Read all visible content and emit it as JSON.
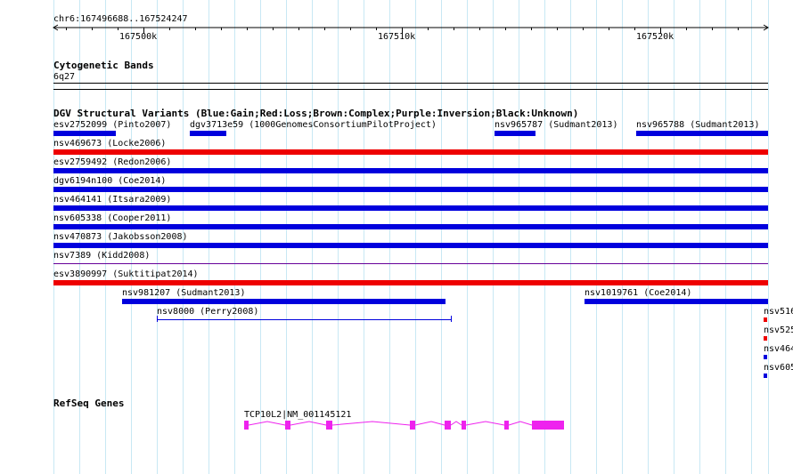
{
  "ruler": {
    "location": "chr6:167496688..167524247",
    "ticks": [
      "167500k",
      "167510k",
      "167520k"
    ]
  },
  "cytobands": {
    "title": "Cytogenetic Bands",
    "band": "6q27"
  },
  "dgv": {
    "title": "DGV Structural Variants (Blue:Gain;Red:Loss;Brown:Complex;Purple:Inversion;Black:Unknown)",
    "colors": {
      "gain": "#0000dd",
      "loss": "#ee0000",
      "inversion": "#660099"
    },
    "features": [
      {
        "label": "esv2752099 (Pinto2007)",
        "type": "gain"
      },
      {
        "label": "dgv3713e59 (1000GenomesConsortiumPilotProject)",
        "type": "gain"
      },
      {
        "label": "nsv965787 (Sudmant2013)",
        "type": "gain"
      },
      {
        "label": "nsv965788 (Sudmant2013)",
        "type": "gain"
      },
      {
        "label": "nsv469673 (Locke2006)",
        "type": "loss"
      },
      {
        "label": "esv2759492 (Redon2006)",
        "type": "gain"
      },
      {
        "label": "dgv6194n100 (Coe2014)",
        "type": "gain"
      },
      {
        "label": "nsv464141 (Itsara2009)",
        "type": "gain"
      },
      {
        "label": "nsv605338 (Cooper2011)",
        "type": "gain"
      },
      {
        "label": "nsv470873 (Jakobsson2008)",
        "type": "gain"
      },
      {
        "label": "nsv7389 (Kidd2008)",
        "type": "inversion"
      },
      {
        "label": "esv3890997 (Suktitipat2014)",
        "type": "loss"
      },
      {
        "label": "nsv981207 (Sudmant2013)",
        "type": "gain"
      },
      {
        "label": "nsv1019761 (Coe2014)",
        "type": "gain"
      },
      {
        "label": "nsv8000 (Perry2008)",
        "type": "gain"
      },
      {
        "label": "nsv516",
        "type": "loss"
      },
      {
        "label": "nsv525",
        "type": "loss"
      },
      {
        "label": "nsv464",
        "type": "gain"
      },
      {
        "label": "nsv605",
        "type": "gain"
      }
    ]
  },
  "refseq": {
    "title": "RefSeq Genes",
    "gene": {
      "label": "TCP10L2|NM_001145121",
      "color": "#ee22ee"
    }
  }
}
